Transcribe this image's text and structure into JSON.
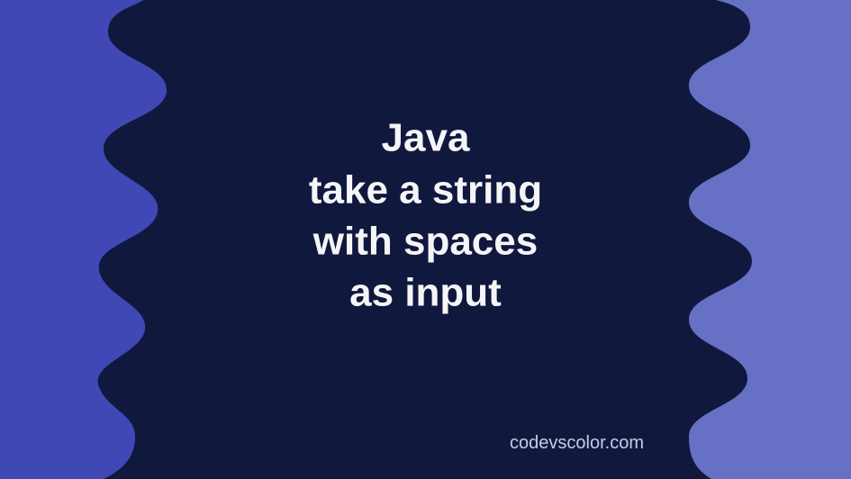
{
  "title": {
    "line1": "Java",
    "line2": "take a string",
    "line3": "with spaces",
    "line4": "as input"
  },
  "footer": {
    "site": "codevscolor.com"
  },
  "colors": {
    "dark_center": "#11183e",
    "left_panel": "#3f48b4",
    "right_panel": "#6670c4",
    "text": "#f5f5f7"
  }
}
